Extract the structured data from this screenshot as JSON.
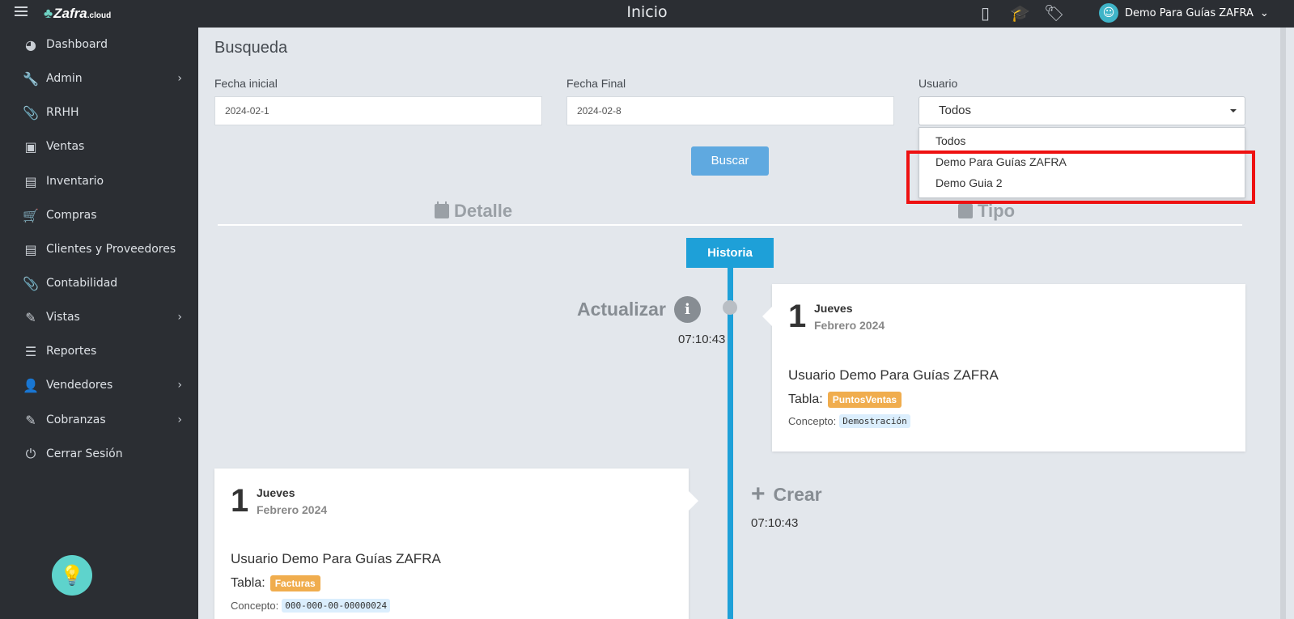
{
  "app": {
    "logo": "Zafra",
    "logo_suffix": ".cloud",
    "page_title": "Inicio"
  },
  "topbar": {
    "user_name": "Demo Para Guías ZAFRA",
    "icons": [
      "mobile-icon",
      "graduation-cap-icon",
      "tags-icon"
    ]
  },
  "sidebar": {
    "items": [
      {
        "label": "Dashboard",
        "icon": "dashboard-icon",
        "has_submenu": false
      },
      {
        "label": "Admin",
        "icon": "wrench-icon",
        "has_submenu": true
      },
      {
        "label": "RRHH",
        "icon": "paperclip-icon",
        "has_submenu": false
      },
      {
        "label": "Ventas",
        "icon": "money-icon",
        "has_submenu": false
      },
      {
        "label": "Inventario",
        "icon": "book-icon",
        "has_submenu": false
      },
      {
        "label": "Compras",
        "icon": "cart-icon",
        "has_submenu": false
      },
      {
        "label": "Clientes y Proveedores",
        "icon": "book-icon",
        "has_submenu": false
      },
      {
        "label": "Contabilidad",
        "icon": "paperclip-icon",
        "has_submenu": false
      },
      {
        "label": "Vistas",
        "icon": "edit-icon",
        "has_submenu": true
      },
      {
        "label": "Reportes",
        "icon": "list-icon",
        "has_submenu": false
      },
      {
        "label": "Vendedores",
        "icon": "user-icon",
        "has_submenu": true
      },
      {
        "label": "Cobranzas",
        "icon": "edit-icon",
        "has_submenu": true
      },
      {
        "label": "Cerrar Sesión",
        "icon": "power-icon",
        "has_submenu": false
      }
    ]
  },
  "search": {
    "title": "Busqueda",
    "fecha_inicial": {
      "label": "Fecha inicial",
      "value": "2024-02-1"
    },
    "fecha_final": {
      "label": "Fecha Final",
      "value": "2024-02-8"
    },
    "usuario": {
      "label": "Usuario",
      "selected": "Todos",
      "options": [
        "Todos",
        "Demo Para Guías ZAFRA",
        "Demo Guia 2"
      ]
    },
    "button": "Buscar"
  },
  "columns": {
    "detalle": "Detalle",
    "tipo": "Tipo"
  },
  "timeline": {
    "header": "Historia",
    "events": [
      {
        "action": "Actualizar",
        "time": "07:10:43",
        "day": "1",
        "weekday": "Jueves",
        "month": "Febrero 2024",
        "user": "Usuario Demo Para Guías ZAFRA",
        "tabla_label": "Tabla:",
        "tabla": "PuntosVentas",
        "concepto_label": "Concepto:",
        "concepto": "Demostración"
      },
      {
        "action": "Crear",
        "time": "07:10:43",
        "day": "1",
        "weekday": "Jueves",
        "month": "Febrero 2024",
        "user": "Usuario Demo Para Guías ZAFRA",
        "tabla_label": "Tabla:",
        "tabla": "Facturas",
        "concepto_label": "Concepto:",
        "concepto": "000-000-00-00000024"
      }
    ]
  },
  "colors": {
    "sidebar_bg": "#2b2e33",
    "accent": "#1ea0d8",
    "button": "#5fa9e0",
    "badge": "#f0ad4e",
    "highlight": "#ee1111"
  }
}
